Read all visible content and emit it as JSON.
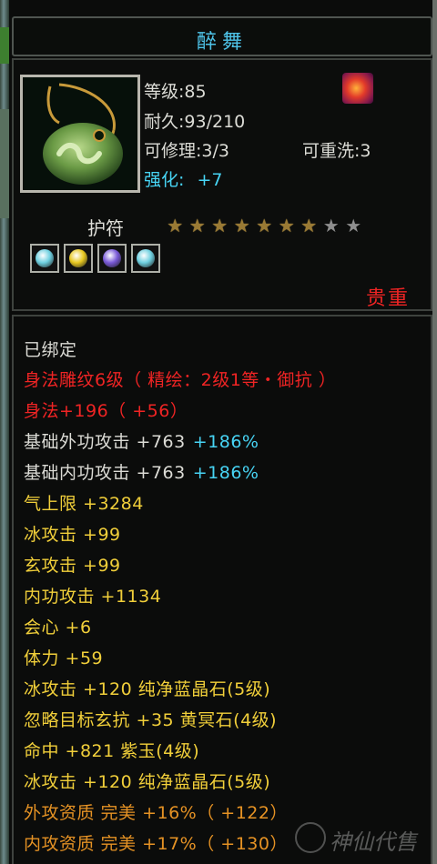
{
  "item": {
    "name": "醉舞",
    "level": "等级:85",
    "durability": "耐久:93/210",
    "repair": "可修理:3/3",
    "reroll": "可重洗:3",
    "enhance_label": "强化:",
    "enhance_value": "+7",
    "type": "护符",
    "stars_on": 7,
    "stars_total": 9,
    "rarity": "贵重"
  },
  "gems": [
    {
      "icon": "blue-crystal-gem-icon",
      "color": "#6fd0e0"
    },
    {
      "icon": "yellow-gem-icon",
      "color": "#e8c820"
    },
    {
      "icon": "purple-gem-icon",
      "color": "#7a5ad8"
    },
    {
      "icon": "blue-crystal-gem-icon",
      "color": "#6fd0e0"
    }
  ],
  "attributes": {
    "bound": "已绑定",
    "engrave": "身法雕纹6级（ 精绘：2级1等・御抗 ）",
    "agility": "身法+196（ +56）",
    "ext_attack_name": "基础外功攻击 +763",
    "ext_attack_pct": "+186%",
    "int_attack_name": "基础内功攻击 +763",
    "int_attack_pct": "+186%",
    "hp": "气上限 +3284",
    "ice_attack": "冰攻击 +99",
    "myst_attack": "玄攻击 +99",
    "int_power": "内功攻击 +1134",
    "crit": "会心 +6",
    "stamina": "体力 +59",
    "ice_gem1": "冰攻击 +120 纯净蓝晶石(5级)",
    "ignore_myst": "忽略目标玄抗 +35 黄冥石(4级)",
    "hit": "命中 +821 紫玉(4级)",
    "ice_gem2": "冰攻击 +120 纯净蓝晶石(5级)",
    "ext_quality": "外攻资质  完美 +16%（ +122）",
    "int_quality": "内攻资质  完美 +17%（ +130）"
  },
  "watermark": "神仙代售"
}
